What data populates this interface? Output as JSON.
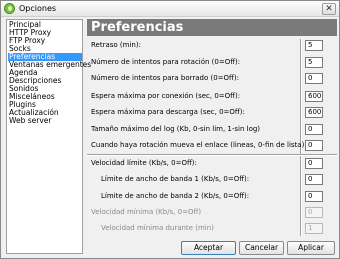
{
  "window": {
    "title": "Opciones"
  },
  "sidebar": {
    "items": [
      {
        "label": "Principal",
        "selected": false
      },
      {
        "label": "HTTP Proxy",
        "selected": false
      },
      {
        "label": "FTP Proxy",
        "selected": false
      },
      {
        "label": "Socks",
        "selected": false
      },
      {
        "label": "Preferencias",
        "selected": true
      },
      {
        "label": "Ventanas emergentes",
        "selected": false
      },
      {
        "label": "Agenda",
        "selected": false
      },
      {
        "label": "Descripciones",
        "selected": false
      },
      {
        "label": "Sonidos",
        "selected": false
      },
      {
        "label": "Misceláneos",
        "selected": false
      },
      {
        "label": "Plugins",
        "selected": false
      },
      {
        "label": "Actualización",
        "selected": false
      },
      {
        "label": "Web server",
        "selected": false
      }
    ]
  },
  "panel": {
    "title": "Preferencias",
    "settings": {
      "retry": {
        "label": "Retraso (min):",
        "value": "5"
      },
      "rotation_attempts": {
        "label": "Número de intentos para rotación (0=Off):",
        "value": "5"
      },
      "delete_attempts": {
        "label": "Número de intentos para borrado (0=Off):",
        "value": "0"
      },
      "connect_wait": {
        "label": "Espera máxima por conexión (sec, 0=Off):",
        "value": "600"
      },
      "download_wait": {
        "label": "Espera máxima para descarga (sec, 0=Off):",
        "value": "600"
      },
      "log_size": {
        "label": "Tamaño máximo del log (Kb, 0-sin lim, 1-sin log)",
        "value": "0"
      },
      "rotation_move": {
        "label": "Cuando haya rotación mueva el enlace (lineas, 0-fin de lista)",
        "value": "0"
      },
      "speed_limit": {
        "label": "Velocidad límite (Kb/s, 0=Off):",
        "value": "0"
      },
      "band1_limit": {
        "label": "Límite de ancho de banda 1 (Kb/s, 0=Off):",
        "value": "0"
      },
      "band2_limit": {
        "label": "Límite de ancho de banda 2 (Kb/s, 0=Off):",
        "value": "0"
      },
      "min_speed": {
        "label": "Velocidad mínima (Kb/s, 0=Off)",
        "value": "0"
      },
      "min_speed_duration": {
        "label": "Velocidad mínima durante (min)",
        "value": "1"
      }
    }
  },
  "buttons": {
    "accept": "Aceptar",
    "cancel": "Cancelar",
    "apply": "Aplicar"
  },
  "colors": {
    "selection": "#3399ff",
    "header": "#7a7a7a",
    "app_icon": "#7cc142"
  }
}
